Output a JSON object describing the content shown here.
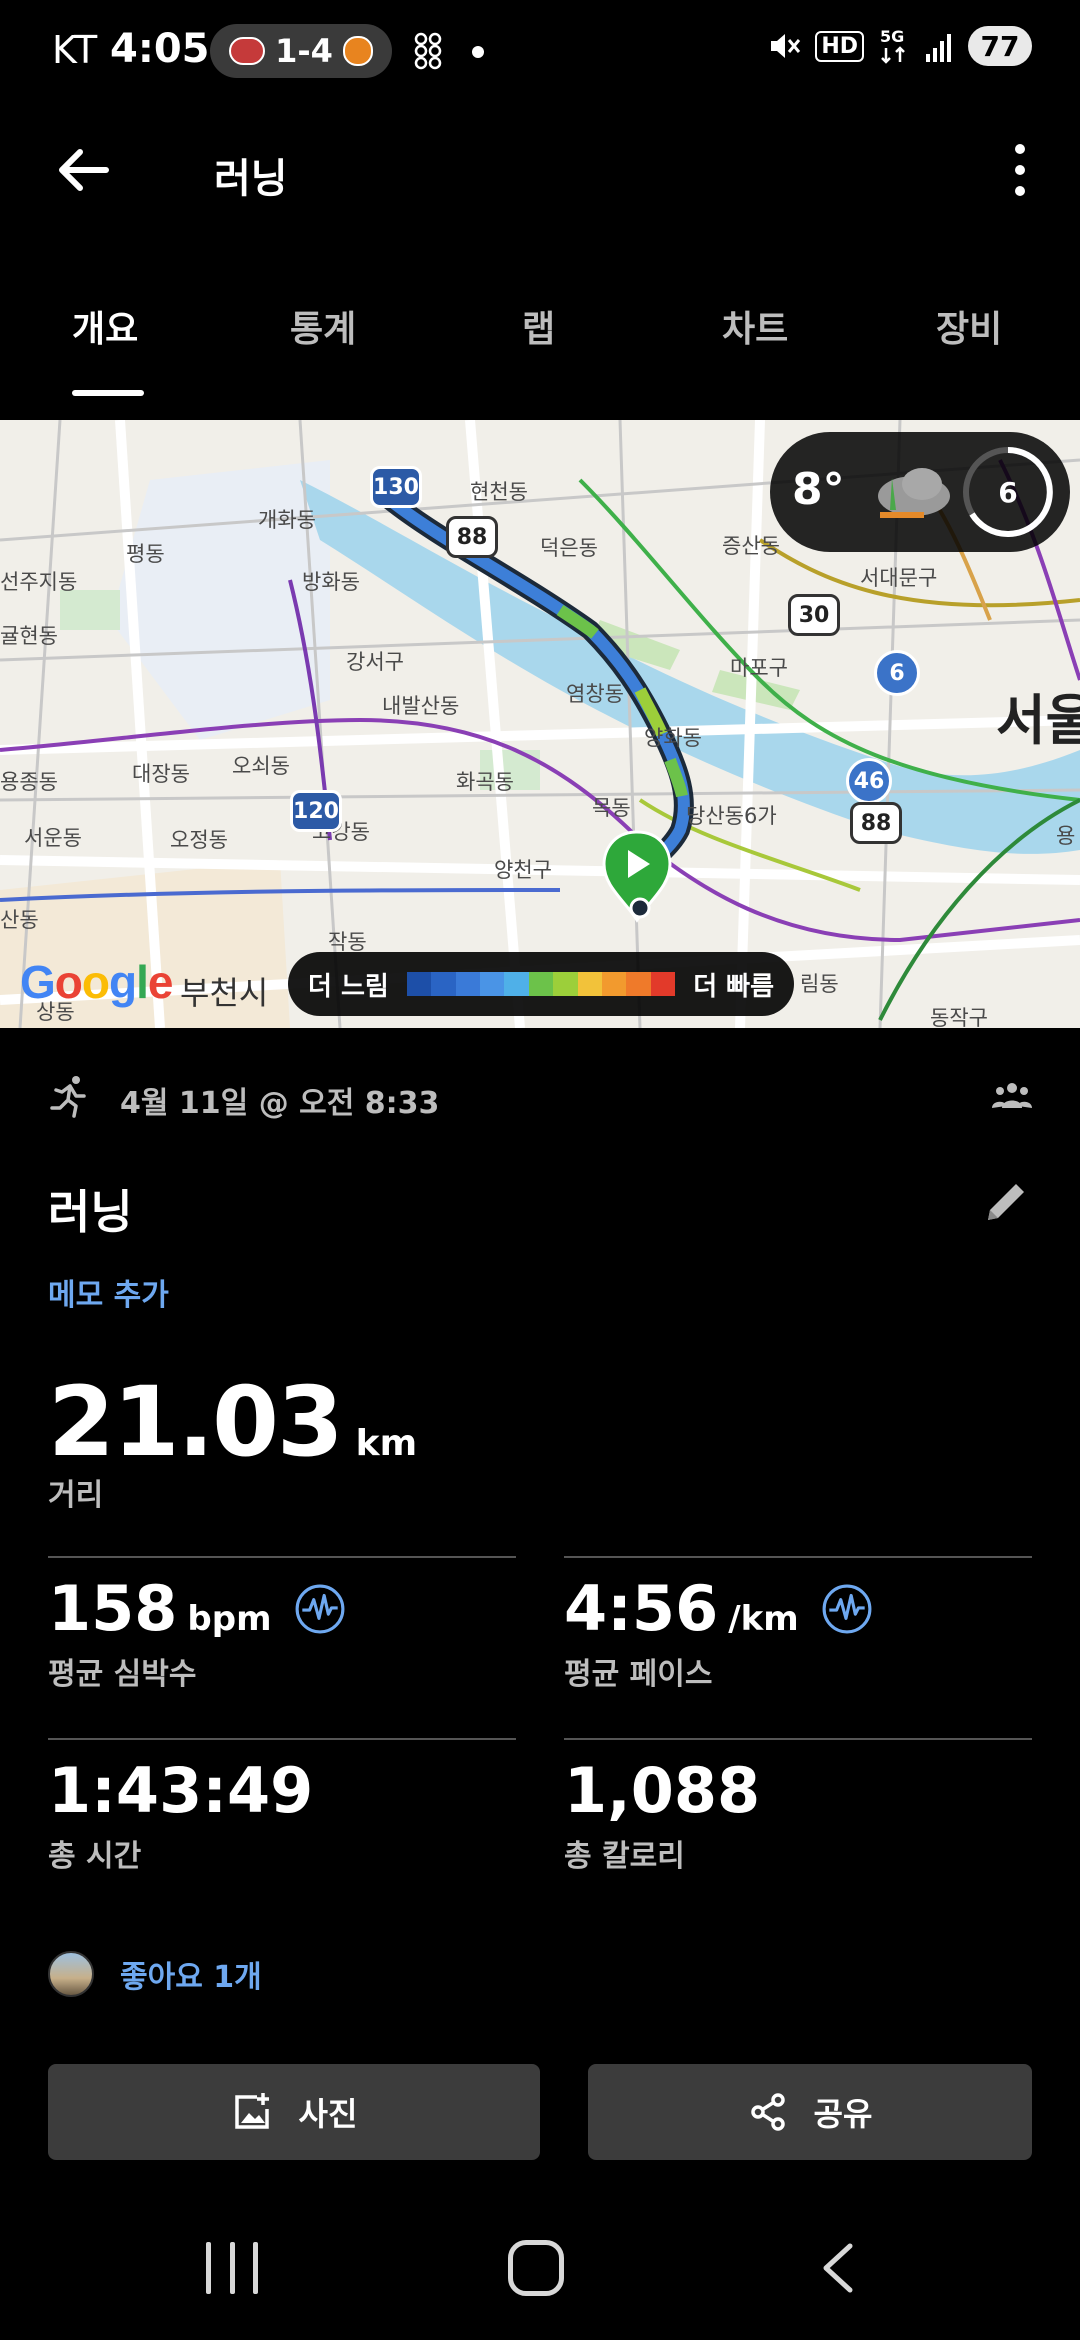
{
  "status_bar": {
    "carrier": "KT",
    "time": "4:05",
    "score": "1-4",
    "battery": "77"
  },
  "app_bar": {
    "title": "러닝"
  },
  "tabs": [
    {
      "label": "개요",
      "active": true
    },
    {
      "label": "통계",
      "active": false
    },
    {
      "label": "랩",
      "active": false
    },
    {
      "label": "차트",
      "active": false
    },
    {
      "label": "장비",
      "active": false
    }
  ],
  "map": {
    "weather": {
      "temperature": "8°",
      "uv_index": "6"
    },
    "labels": {
      "l1": "현천동",
      "l2": "개화동",
      "l3": "덕은동",
      "l4": "증산동",
      "l5": "평동",
      "l6": "방화동",
      "l7": "선주지동",
      "l8": "서대문구",
      "l9": "귤현동",
      "l10": "강서구",
      "l11": "마포구",
      "l12": "내발산동",
      "l13": "염창동",
      "l14": "서울",
      "l15": "대장동",
      "l16": "오쇠동",
      "l17": "양화동",
      "l18": "용종동",
      "l19": "화곡동",
      "l20": "목동",
      "l21": "당산동6가",
      "l22": "서운동",
      "l23": "오정동",
      "l24": "고강동",
      "l25": "양천구",
      "l26": "산동",
      "l27": "작동",
      "l28": "부천시",
      "l29": "상동",
      "l30": "림동",
      "l31": "동작구",
      "l32": "용"
    },
    "shields": {
      "s130": "130",
      "s88a": "88",
      "s30": "30",
      "s6": "6",
      "s46": "46",
      "s120": "120",
      "s88b": "88"
    },
    "attribution": {
      "g1": "G",
      "g2": "o",
      "g3": "o",
      "g4": "g",
      "g5": "l",
      "g6": "e"
    },
    "legend": {
      "slow_label": "더 느림",
      "fast_label": "더 빠름",
      "colors": [
        "#1d4fa8",
        "#2a64c4",
        "#3a7ad8",
        "#4a94e6",
        "#4fb0e8",
        "#6cc24a",
        "#9ccf3a",
        "#f2c23a",
        "#f29a2e",
        "#ef7a2a",
        "#e23a2a"
      ]
    },
    "route_colors": {
      "primary": "#3d7fd8",
      "fast": "#6cc24a",
      "start": "#2ea83a"
    }
  },
  "activity": {
    "date": "4월 11일 @ 오전 8:33",
    "title": "러닝",
    "memo_link": "메모 추가",
    "distance": {
      "value": "21.03",
      "unit": "km",
      "label": "거리"
    },
    "heart_rate": {
      "value": "158",
      "unit": "bpm",
      "label": "평균 심박수"
    },
    "pace": {
      "value": "4:56",
      "unit": "/km",
      "label": "평균 페이스"
    },
    "total_time": {
      "value": "1:43:49",
      "label": "총 시간"
    },
    "calories": {
      "value": "1,088",
      "label": "총 칼로리"
    },
    "likes": "좋아요 1개"
  },
  "actions": {
    "photo_label": "사진",
    "share_label": "공유"
  },
  "accent_color": "#6ea8f0"
}
